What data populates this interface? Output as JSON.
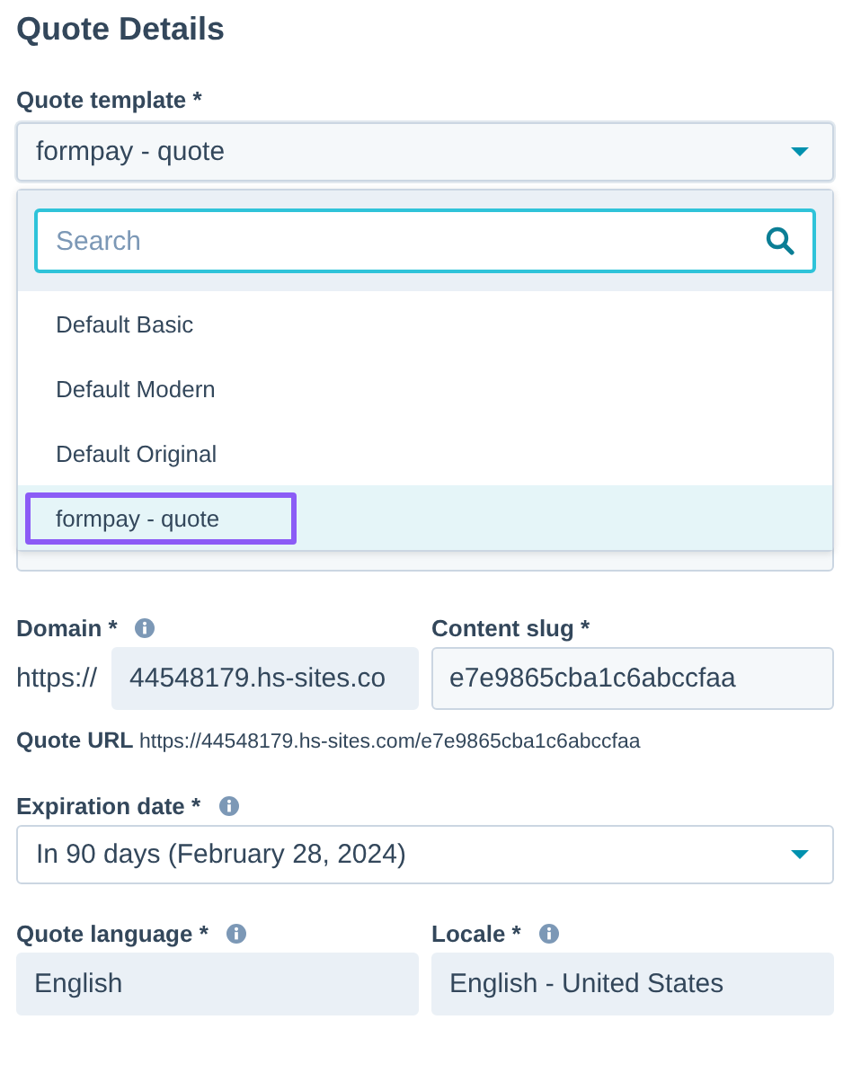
{
  "heading": "Quote Details",
  "quote_template": {
    "label": "Quote template *",
    "value": "formpay - quote",
    "expanded": true
  },
  "dropdown": {
    "search_placeholder": "Search",
    "options": [
      {
        "label": "Default Basic",
        "selected": false
      },
      {
        "label": "Default Modern",
        "selected": false
      },
      {
        "label": "Default Original",
        "selected": false
      },
      {
        "label": "formpay - quote",
        "selected": true
      }
    ]
  },
  "domain": {
    "label": "Domain *",
    "prefix": "https://",
    "value": "44548179.hs-sites.co"
  },
  "content_slug": {
    "label": "Content slug *",
    "value": "e7e9865cba1c6abccfaa"
  },
  "quote_url": {
    "label": "Quote URL",
    "value": "https://44548179.hs-sites.com/e7e9865cba1c6abccfaa"
  },
  "expiration_date": {
    "label": "Expiration date *",
    "value": "In 90 days (February 28, 2024)"
  },
  "quote_language": {
    "label": "Quote language *",
    "value": "English"
  },
  "locale": {
    "label": "Locale *",
    "value": "English - United States"
  }
}
